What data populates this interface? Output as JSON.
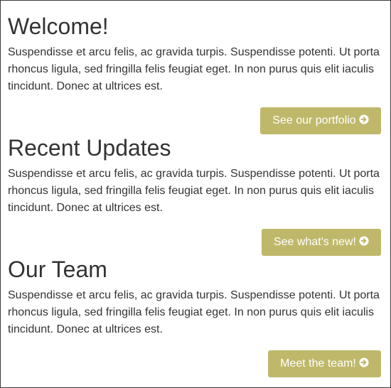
{
  "theme": {
    "accent_color": "#bfb86a",
    "text_color": "#333333",
    "border_color": "#3a3a3a"
  },
  "sections": [
    {
      "heading": "Welcome!",
      "body": "Suspendisse et arcu felis, ac gravida turpis. Suspendisse potenti. Ut porta rhoncus ligula, sed fringilla felis feugiat eget. In non purus quis elit iaculis tincidunt. Donec at ultrices est.",
      "button_label": "See our portfolio",
      "button_icon": "circle-arrow-right-icon"
    },
    {
      "heading": "Recent Updates",
      "body": "Suspendisse et arcu felis, ac gravida turpis. Suspendisse potenti. Ut porta rhoncus ligula, sed fringilla felis feugiat eget. In non purus quis elit iaculis tincidunt. Donec at ultrices est.",
      "button_label": "See what's new!",
      "button_icon": "circle-arrow-right-icon"
    },
    {
      "heading": "Our Team",
      "body": "Suspendisse et arcu felis, ac gravida turpis. Suspendisse potenti. Ut porta rhoncus ligula, sed fringilla felis feugiat eget. In non purus quis elit iaculis tincidunt. Donec at ultrices est.",
      "button_label": "Meet the team!",
      "button_icon": "circle-arrow-right-icon"
    }
  ]
}
